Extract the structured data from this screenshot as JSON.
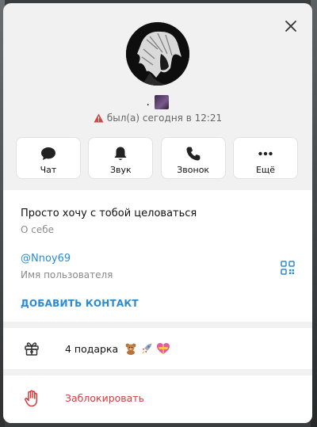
{
  "profile": {
    "name": ".",
    "status": "был(а) сегодня в 12:21"
  },
  "actions": [
    {
      "label": "Чат",
      "icon": "chat-icon"
    },
    {
      "label": "Звук",
      "icon": "bell-icon"
    },
    {
      "label": "Звонок",
      "icon": "phone-icon"
    },
    {
      "label": "Ещё",
      "icon": "more-icon"
    }
  ],
  "info": {
    "bio": "Просто хочу с тобой целоваться",
    "bio_caption": "О себе",
    "username": "@Nnoy69",
    "username_caption": "Имя пользователя",
    "add_contact": "ДОБАВИТЬ КОНТАКТ"
  },
  "gifts": {
    "label": "4 подарка"
  },
  "block": {
    "label": "Заблокировать"
  },
  "colors": {
    "accent": "#2a8bd3",
    "danger": "#d23c3c"
  }
}
